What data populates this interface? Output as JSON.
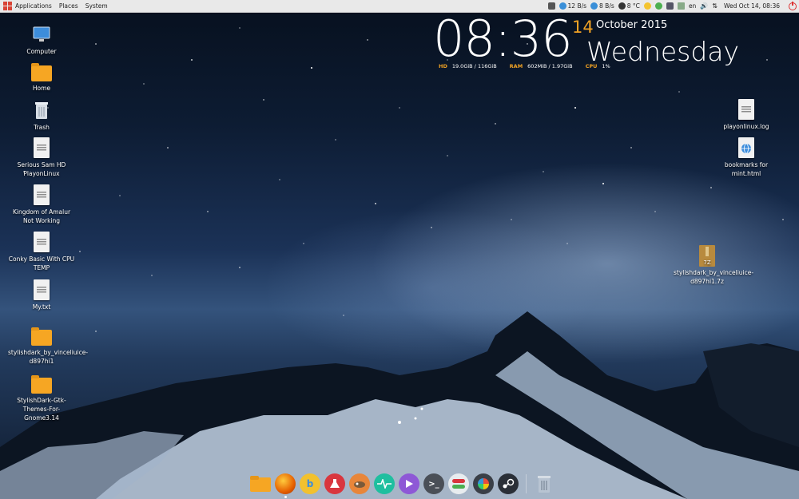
{
  "panel": {
    "menus": [
      "Applications",
      "Places",
      "System"
    ],
    "net_down": "12 B/s",
    "net_up": "8 B/s",
    "temperature": "8 °C",
    "language": "en",
    "datetime": "Wed Oct 14, 08:36"
  },
  "conky": {
    "time": "08:36",
    "day": "14",
    "month_year": "October 2015",
    "weekday": "Wednesday",
    "hd_label": "HD",
    "hd_value": "19.0GiB / 116GiB",
    "ram_label": "RAM",
    "ram_value": "602MiB / 1.97GiB",
    "cpu_label": "CPU",
    "cpu_value": "1%",
    "accent_color": "#f0a224"
  },
  "desktop_icons_left": [
    {
      "label": "Computer",
      "icon": "computer-icon"
    },
    {
      "label": "Home",
      "icon": "home-folder-icon"
    },
    {
      "label": "Trash",
      "icon": "trash-icon"
    },
    {
      "label": "Serious Sam HD PlayonLinux",
      "icon": "script-file-icon"
    },
    {
      "label": "Kingdom of Amalur Not Working",
      "icon": "script-file-icon"
    },
    {
      "label": "Conky Basic With CPU TEMP",
      "icon": "script-file-icon"
    },
    {
      "label": "My.txt",
      "icon": "text-file-icon"
    },
    {
      "label": "stylishdark_by_vinceliuice-d897hi1",
      "icon": "folder-icon"
    },
    {
      "label": "StylishDark-Gtk-Themes-For-Gnome3.14",
      "icon": "folder-icon"
    }
  ],
  "desktop_icons_right": [
    {
      "label": "playonlinux.log",
      "icon": "text-file-icon"
    },
    {
      "label": "bookmarks for mint.html",
      "icon": "html-file-icon"
    },
    {
      "label": "stylishdark_by_vinceliuice-d897hi1.7z",
      "icon": "archive-icon",
      "badge": "7Z"
    }
  ],
  "dock": [
    {
      "name": "files",
      "icon": "files-icon",
      "color": "#f6a623"
    },
    {
      "name": "firefox",
      "icon": "firefox-icon",
      "color": "#e66000"
    },
    {
      "name": "bittorrent",
      "icon": "bittorrent-icon",
      "color": "#f2c12e",
      "glyph": "b"
    },
    {
      "name": "app-installer",
      "icon": "flask-icon",
      "color": "#d9363e"
    },
    {
      "name": "gimp",
      "icon": "gimp-icon",
      "color": "#e8863a"
    },
    {
      "name": "system-monitor",
      "icon": "system-monitor-icon",
      "color": "#1fbf9f"
    },
    {
      "name": "media-player",
      "icon": "play-icon",
      "color": "#8e58d6"
    },
    {
      "name": "terminal",
      "icon": "terminal-icon",
      "color": "#4a4f57",
      "glyph": ">_"
    },
    {
      "name": "settings",
      "icon": "toggle-icon",
      "color": "#e8ecef"
    },
    {
      "name": "pinwheel",
      "icon": "pinwheel-icon",
      "color": "#3a3f47"
    },
    {
      "name": "steam",
      "icon": "steam-icon",
      "color": "#2a2f37"
    },
    {
      "name": "trash",
      "icon": "trash-icon",
      "color": "#b8c4d2"
    }
  ]
}
